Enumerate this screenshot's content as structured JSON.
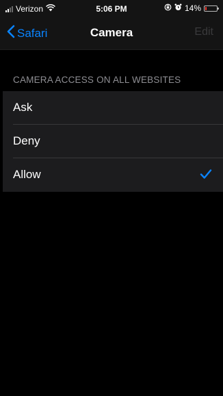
{
  "status_bar": {
    "carrier": "Verizon",
    "time": "5:06 PM",
    "battery_percent": "14%",
    "battery_level": 0.14,
    "icons": [
      "signal-icon",
      "wifi-icon",
      "lock-rotation-icon",
      "alarm-icon",
      "battery-icon"
    ]
  },
  "nav": {
    "back_label": "Safari",
    "title": "Camera",
    "edit_label": "Edit"
  },
  "section": {
    "header": "CAMERA ACCESS ON ALL WEBSITES",
    "options": [
      {
        "label": "Ask",
        "selected": false
      },
      {
        "label": "Deny",
        "selected": false
      },
      {
        "label": "Allow",
        "selected": true
      }
    ]
  },
  "colors": {
    "accent": "#0a84ff",
    "background": "#000000",
    "cell_background": "#1c1c1e",
    "secondary_text": "#8e8e93",
    "battery_low": "#ff3b30"
  }
}
